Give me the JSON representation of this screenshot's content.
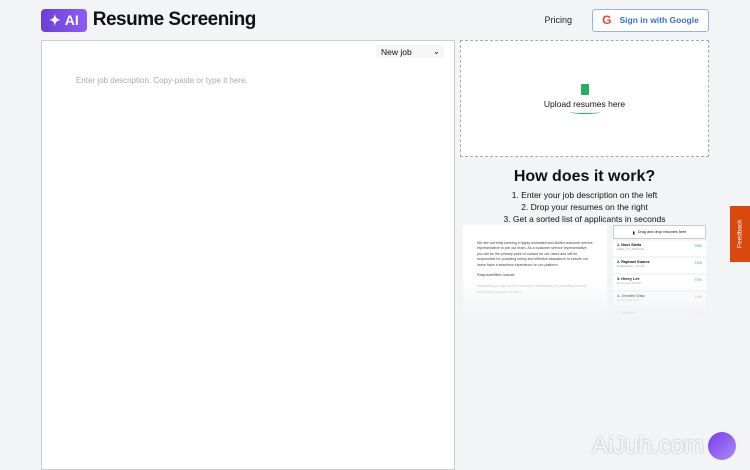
{
  "header": {
    "logo_badge": "AI",
    "logo_sparkle": "✦",
    "title": "Resume Screening",
    "pricing": "Pricing",
    "signin": "Sign in with Google"
  },
  "job": {
    "select_value": "New job",
    "placeholder": "Enter job description. Copy-paste or type it here."
  },
  "upload": {
    "label": "Upload resumes here"
  },
  "how": {
    "title": "How does it work?",
    "steps": [
      "1. Enter your job description on the left",
      "2. Drop your resumes on the right",
      "3. Get a sorted list of applicants in seconds"
    ]
  },
  "demo": {
    "jd": "We are currently seeking a highly motivated and skilled customer service representative to join our team. As a customer service representative, you will be the primary point of contact for our users and will be responsible for providing timely and effective assistance to ensure our users have a seamless experience on our platform.",
    "resp": "Responsibilities include:",
    "resp_text": "Maintaining a high level of customer satisfaction by providing friendly and helpful support to users.",
    "drop": "Drag and drop resumes here",
    "results": [
      {
        "name": "1. Noor Stella",
        "file": "Stella_CV_2023.pdf",
        "pct": "78%"
      },
      {
        "name": "2. Raphael Suarez",
        "file": "RaphSuarez_CV.pdf",
        "pct": "74%"
      },
      {
        "name": "3. Henry Lee",
        "file": "Henry-Lee-CV.pdf",
        "pct": "70%"
      },
      {
        "name": "4. Jennifer Diaz",
        "file": "JenniferDiaz.pdf",
        "pct": "74%"
      },
      {
        "name": "5. Wei Wu",
        "file": "",
        "pct": "70%"
      }
    ]
  },
  "feedback": "Feedback",
  "watermark": "AiJuh.com",
  "colors": {
    "brand": "#7c4ddb",
    "google_blue": "#3b6fd1",
    "success": "#27ae60",
    "feedback": "#d9480f"
  }
}
